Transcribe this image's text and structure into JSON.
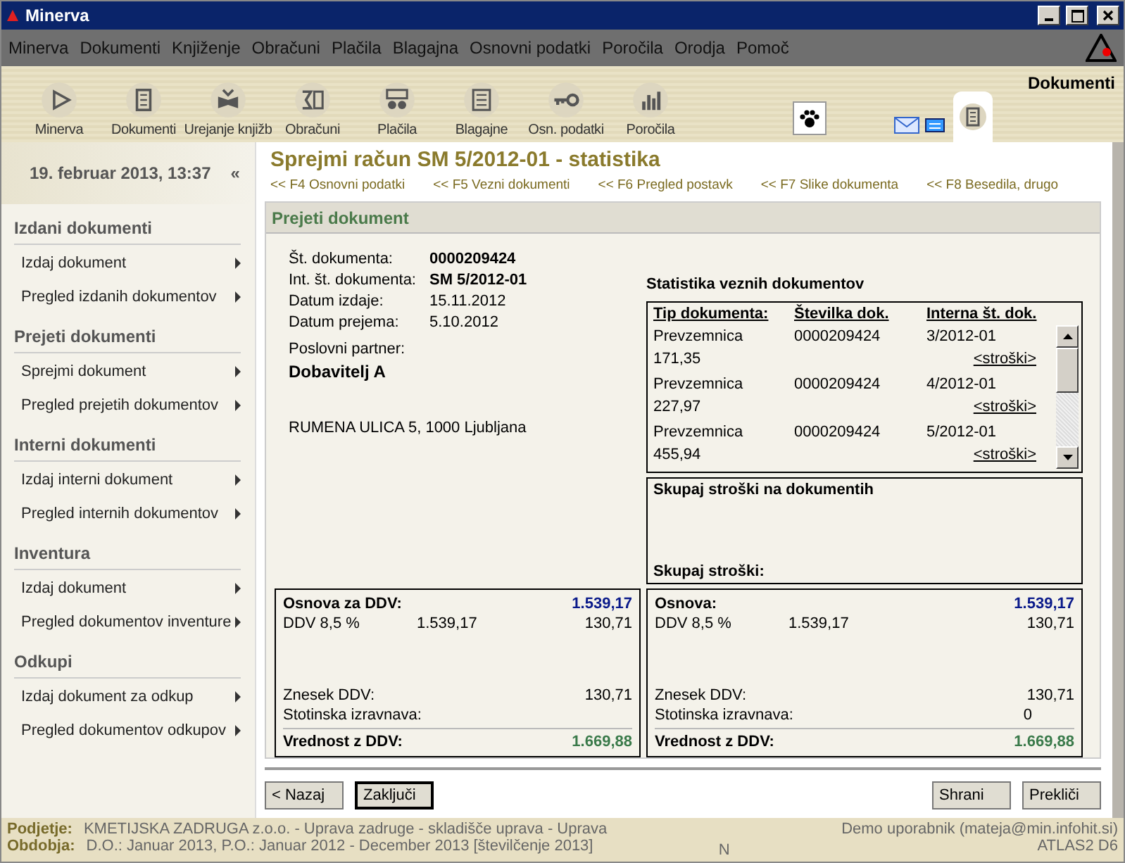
{
  "window": {
    "title": "Minerva"
  },
  "menu": [
    "Minerva",
    "Dokumenti",
    "Knjiženje",
    "Obračuni",
    "Plačila",
    "Blagajna",
    "Osnovni podatki",
    "Poročila",
    "Orodja",
    "Pomoč"
  ],
  "toolbar": {
    "buttons": [
      "Minerva",
      "Dokumenti",
      "Urejanje knjižb",
      "Obračuni",
      "Plačila",
      "Blagajne",
      "Osn. podatki",
      "Poročila"
    ],
    "section": "Dokumenti"
  },
  "sidebar": {
    "date": "19. februar 2013, 13:37",
    "collapse": "«",
    "sections": [
      {
        "title": "Izdani dokumenti",
        "items": [
          "Izdaj dokument",
          "Pregled izdanih dokumentov"
        ]
      },
      {
        "title": "Prejeti dokumenti",
        "items": [
          "Sprejmi dokument",
          "Pregled prejetih dokumentov"
        ]
      },
      {
        "title": "Interni dokumenti",
        "items": [
          "Izdaj interni dokument",
          "Pregled internih dokumentov"
        ]
      },
      {
        "title": "Inventura",
        "items": [
          "Izdaj dokument",
          "Pregled dokumentov inventure"
        ]
      },
      {
        "title": "Odkupi",
        "items": [
          "Izdaj dokument za odkup",
          "Pregled dokumentov odkupov"
        ]
      }
    ]
  },
  "page": {
    "title": "Sprejmi račun SM 5/2012-01 - statistika",
    "shortcuts": [
      "<< F4 Osnovni podatki",
      "<< F5 Vezni dokumenti",
      "<< F6 Pregled postavk",
      "<< F7 Slike dokumenta",
      "<< F8 Besedila, drugo"
    ],
    "panel_title": "Prejeti dokument",
    "fields": [
      {
        "label": "Št. dokumenta:",
        "value": "0000209424",
        "bold": true
      },
      {
        "label": "Int. št. dokumenta:",
        "value": "SM 5/2012-01",
        "bold": true
      },
      {
        "label": "Datum izdaje:",
        "value": "15.11.2012",
        "bold": false
      },
      {
        "label": "Datum prejema:",
        "value": "5.10.2012",
        "bold": false
      }
    ],
    "partner": {
      "label": "Poslovni partner:",
      "name": "Dobavitelj A",
      "address": "RUMENA ULICA 5, 1000 Ljubljana"
    },
    "stats": {
      "title": "Statistika veznih dokumentov",
      "columns": [
        "Tip dokumenta:",
        "Številka dok.",
        "Interna št. dok."
      ],
      "rows": [
        {
          "type": "Prevzemnica",
          "number": "0000209424",
          "internal": "3/2012-01",
          "amount": "171,35",
          "link": "<stroški>"
        },
        {
          "type": "Prevzemnica",
          "number": "0000209424",
          "internal": "4/2012-01",
          "amount": "227,97",
          "link": "<stroški>"
        },
        {
          "type": "Prevzemnica",
          "number": "0000209424",
          "internal": "5/2012-01",
          "amount": "455,94",
          "link": "<stroški>"
        }
      ]
    },
    "costs": {
      "title": "Skupaj stroški na dokumentih",
      "total_label": "Skupaj stroški:"
    },
    "vat_boxes": [
      {
        "base_label": "Osnova za DDV:",
        "base_value": "1.539,17",
        "rate_label": "DDV 8,5 %",
        "rate_base": "1.539,17",
        "rate_value": "130,71",
        "vat_label": "Znesek DDV:",
        "vat_value": "130,71",
        "rounding_label": "Stotinska izravnava:",
        "total_label": "Vrednost z DDV:",
        "total_value": "1.669,88"
      },
      {
        "base_label": "Osnova:",
        "base_value": "1.539,17",
        "rate_label": "DDV 8,5 %",
        "rate_base": "1.539,17",
        "rate_value": "130,71",
        "vat_label": "Znesek DDV:",
        "vat_value": "130,71",
        "rounding_label": "Stotinska izravnava:",
        "rounding_value": "0",
        "total_label": "Vrednost z DDV:",
        "total_value": "1.669,88"
      }
    ],
    "buttons_left": [
      {
        "label": "< Nazaj",
        "default": false
      },
      {
        "label": "Zaključi",
        "default": true
      }
    ],
    "buttons_right": [
      {
        "label": "Shrani",
        "default": false
      },
      {
        "label": "Prekliči",
        "default": false
      }
    ]
  },
  "status_bar": {
    "company_label": "Podjetje:",
    "company": "KMETIJSKA ZADRUGA z.o.o. - Uprava zadruge - skladišče uprava - Uprava",
    "period_label": "Obdobja:",
    "period": "D.O.: Januar 2013, P.O.: Januar 2012 - December 2013 [številčenje 2013]",
    "mode": "N",
    "user": "Demo uporabnik (mateja@min.infohit.si)",
    "version": "ATLAS2 D6"
  }
}
